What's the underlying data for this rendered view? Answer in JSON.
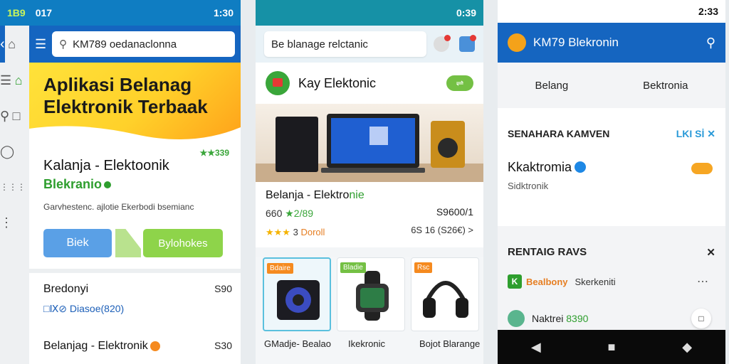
{
  "phone1": {
    "status": {
      "left": "1B9",
      "center": "017",
      "right": "1:30"
    },
    "search_placeholder": "KM789 oedanaclonna",
    "hero_title": "Aplikasi Belanag Elektronik Terbaak",
    "card_title": "Kalanja - Elektoonik",
    "card_subtitle": "Blekranio",
    "rating_text": "★★339",
    "description": "Garvhestenc. ajlotie Ekerbodi bsemianc",
    "btn_primary": "Biek",
    "btn_secondary": "Bylohokes",
    "list": [
      {
        "name": "Bredonyi",
        "price": "S90",
        "meta": "□Ⅸ⊘ Diasoe(820)"
      },
      {
        "name": "Belanjag - Elektronik",
        "price": "S30"
      }
    ],
    "rail_icons": [
      "home-icon",
      "list-icon",
      "home-alt-icon",
      "search-icon",
      "book-icon",
      "tag-icon",
      "grid-icon",
      "dots-icon"
    ]
  },
  "phone2": {
    "status": {
      "right": "0:39"
    },
    "search_text": "Be blanage relctanic",
    "store_name": "Kay Elektonic",
    "product_title": "Belanja - Elektro",
    "product_title_green": "nie",
    "rating_row": {
      "left": "660",
      "stars": "★2/89",
      "right": "S9600/1"
    },
    "detail_row": {
      "stars": "★★★",
      "num": "3",
      "link": "Doroll",
      "right": "6S 16 (S26€)  >"
    },
    "tiles": [
      {
        "tag": "Bdaire",
        "tag_color": "#f58a1f"
      },
      {
        "tag": "Bladie",
        "tag_color": "#74c044"
      },
      {
        "tag": "Rsc",
        "tag_color": "#f58a1f"
      }
    ],
    "tiles_footer": {
      "left": "GMadje- Bealao",
      "center": "Ikekronic",
      "right": "Bojot Blarange"
    }
  },
  "phone3": {
    "status": {
      "right": "2:33"
    },
    "app_title": "KM79 Blekronin",
    "tabs": [
      "Belang",
      "Bektronia"
    ],
    "section1": {
      "title": "SENAHARA KAMVEN",
      "action": "LKI Sİ ✕",
      "item_title": "Kkaktromia",
      "item_sub": "Sidktronik"
    },
    "section2": {
      "title": "RENTAIG RAVS",
      "items": [
        {
          "icon": "K",
          "brand": "Bealbony",
          "sub": "Skerkeniti"
        },
        {
          "name": "Naktrei",
          "green": "8390"
        }
      ]
    }
  }
}
